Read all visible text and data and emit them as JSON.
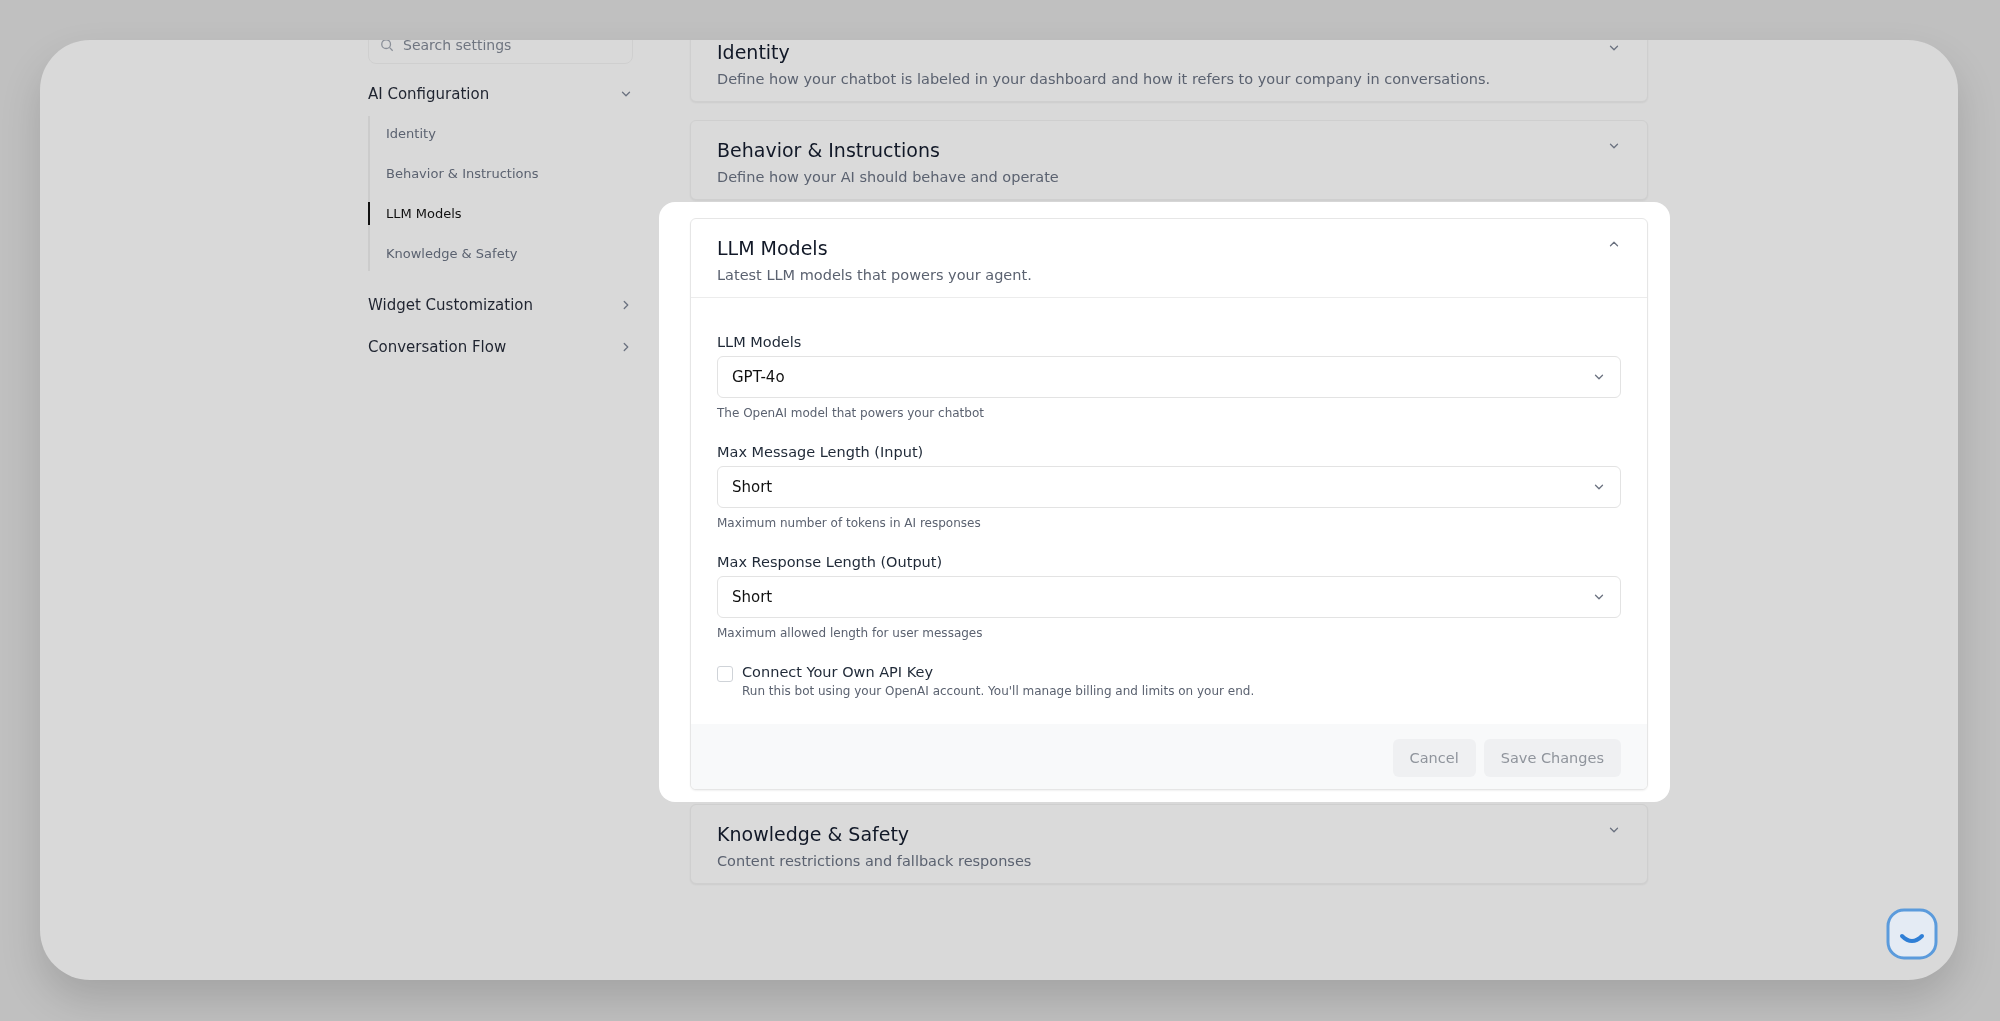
{
  "sidebar": {
    "search": {
      "placeholder": "Search settings"
    },
    "groups": [
      {
        "label": "AI Configuration",
        "expanded": true,
        "children": [
          {
            "label": "Identity",
            "selected": false
          },
          {
            "label": "Behavior & Instructions",
            "selected": false
          },
          {
            "label": "LLM Models",
            "selected": true
          },
          {
            "label": "Knowledge & Safety",
            "selected": false
          }
        ]
      },
      {
        "label": "Widget Customization",
        "expanded": false
      },
      {
        "label": "Conversation Flow",
        "expanded": false
      }
    ]
  },
  "sections": [
    {
      "title": "Identity",
      "description": "Define how your chatbot is labeled in your dashboard and how it refers to your company in conversations.",
      "expanded": false
    },
    {
      "title": "Behavior & Instructions",
      "description": "Define how your AI should behave and operate",
      "expanded": false
    },
    {
      "title": "LLM Models",
      "description": "Latest LLM models that powers your agent.",
      "expanded": true,
      "fields": [
        {
          "kind": "select",
          "label": "LLM Models",
          "value": "GPT-4o",
          "help": "The OpenAI model that powers your chatbot"
        },
        {
          "kind": "select",
          "label": "Max Message Length (Input)",
          "value": "Short",
          "help": "Maximum number of tokens in AI responses"
        },
        {
          "kind": "select",
          "label": "Max Response Length (Output)",
          "value": "Short",
          "help": "Maximum allowed length for user messages"
        },
        {
          "kind": "checkbox",
          "label": "Connect Your Own API Key",
          "help": "Run this bot using your OpenAI account. You'll manage billing and limits on your end.",
          "checked": false
        }
      ],
      "buttons": [
        {
          "label": "Cancel",
          "disabled": true
        },
        {
          "label": "Save Changes",
          "disabled": true
        }
      ]
    },
    {
      "title": "Knowledge & Safety",
      "description": "Content restrictions and fallback responses",
      "expanded": false
    }
  ]
}
